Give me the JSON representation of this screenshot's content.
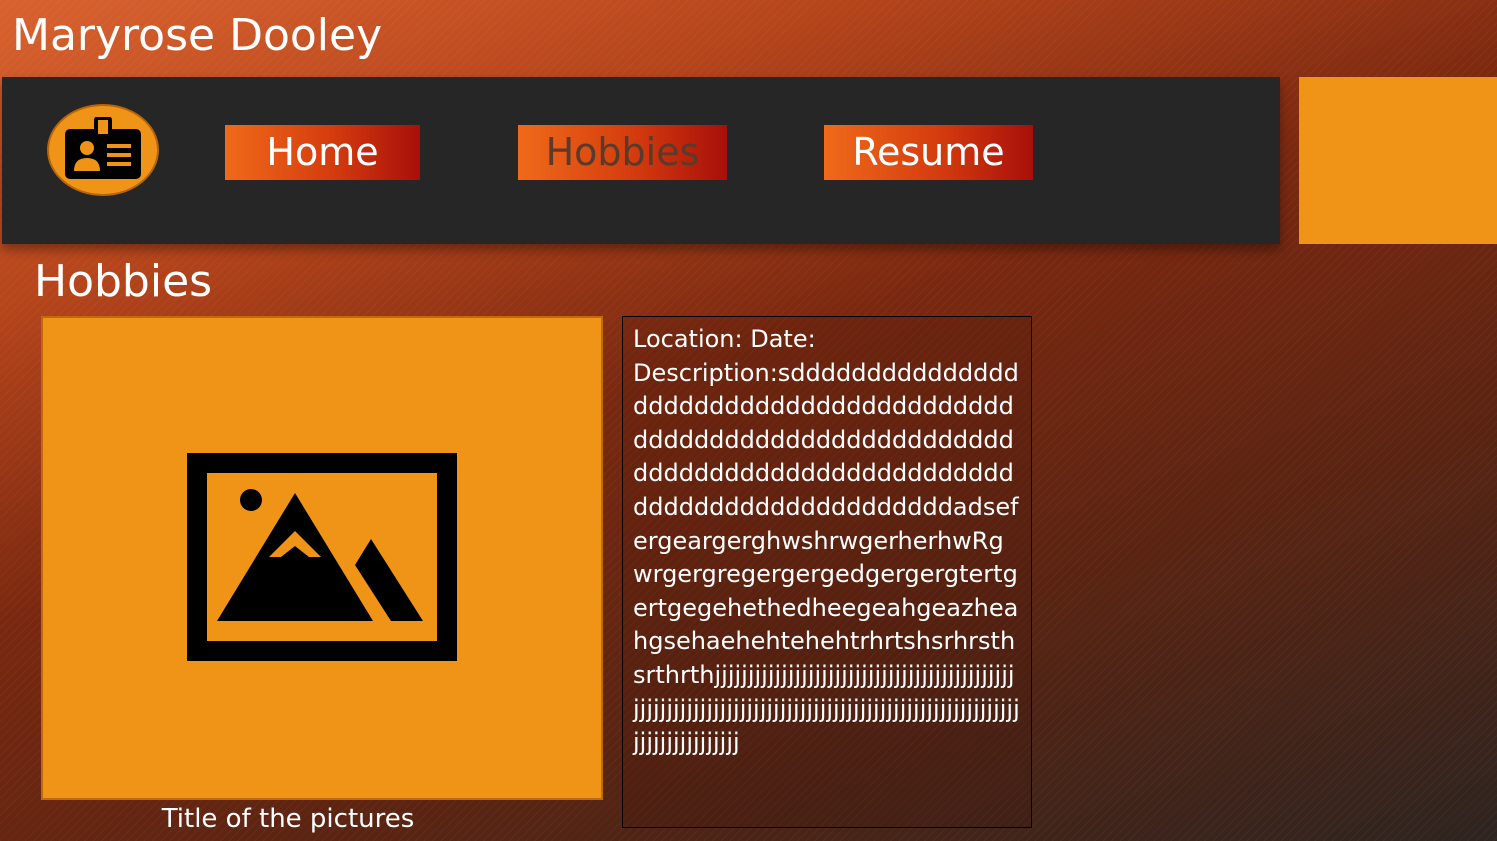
{
  "header": {
    "title": "Maryrose Dooley"
  },
  "nav": {
    "logo_icon": "id-badge-icon",
    "items": [
      {
        "label": "Home",
        "active": false
      },
      {
        "label": "Hobbies",
        "active": true
      },
      {
        "label": "Resume",
        "active": false
      }
    ]
  },
  "main": {
    "heading": "Hobbies",
    "picture": {
      "icon": "image-placeholder-icon",
      "caption": "Title of the pictures"
    },
    "details": {
      "location_label": "Location:",
      "date_label": "Date:",
      "description_label": "Description:",
      "description_text": "sdddddddddddddddddddddddddddddddddddddddddddddddddddddddddddddddddddddddddddddddddddddddddddddddddddddddddddddddadsefergeargerghwshrwgerherhwRgwrgergregergergedgergergtertgertgegehethedheegeahgeazheahgsehaehehtehehtrhrtshsrhrsthsrthrthjjjjjjjjjjjjjjjjjjjjjjjjjjjjjjjjjjjjjjjjjjjjjjjjjjjjjjjjjjjjjjjjjjjjjjjjjjjjjjjjjjjjjjjjjjjjjjjjjjjjjjjjjjjjjjjjjjjjjjj"
    }
  },
  "colors": {
    "accent": "#ef9417",
    "nav_background": "#262626",
    "button_gradient_start": "#f06a1a",
    "button_gradient_end": "#a80f0a"
  }
}
